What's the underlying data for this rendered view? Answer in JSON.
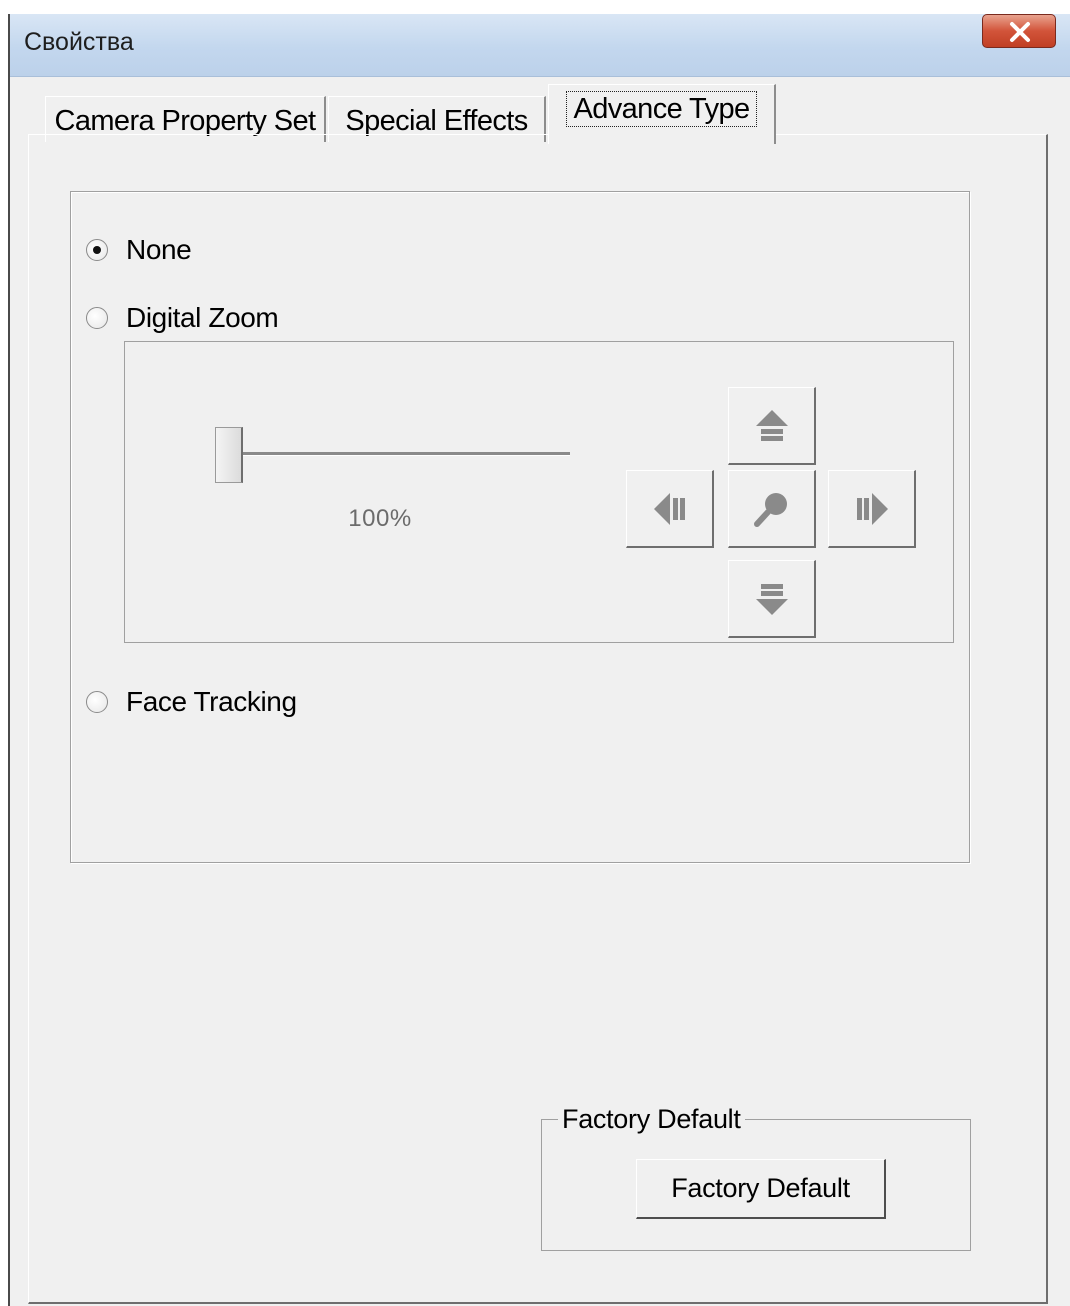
{
  "window": {
    "title": "Свойства",
    "close_icon": "close-icon"
  },
  "tabs": [
    {
      "label": "Camera Property Set",
      "active": false
    },
    {
      "label": "Special Effects",
      "active": false
    },
    {
      "label": "Advance Type",
      "active": true
    }
  ],
  "advance": {
    "options": [
      {
        "label": "None",
        "checked": true
      },
      {
        "label": "Digital Zoom",
        "checked": false
      },
      {
        "label": "Face Tracking",
        "checked": false
      }
    ],
    "zoom": {
      "value_text": "100%",
      "slider_level": 0,
      "buttons": [
        "up-arrow-icon",
        "left-arrow-icon",
        "zoom-magnifier-icon",
        "right-arrow-icon",
        "down-arrow-icon"
      ]
    }
  },
  "factory": {
    "group_label": "Factory Default",
    "button_label": "Factory Default"
  },
  "colors": {
    "face": "#f0f0f0",
    "titlebar": "#c3d7ee",
    "close_button": "#c94a2f",
    "icon_gray": "#8a8a8a"
  }
}
